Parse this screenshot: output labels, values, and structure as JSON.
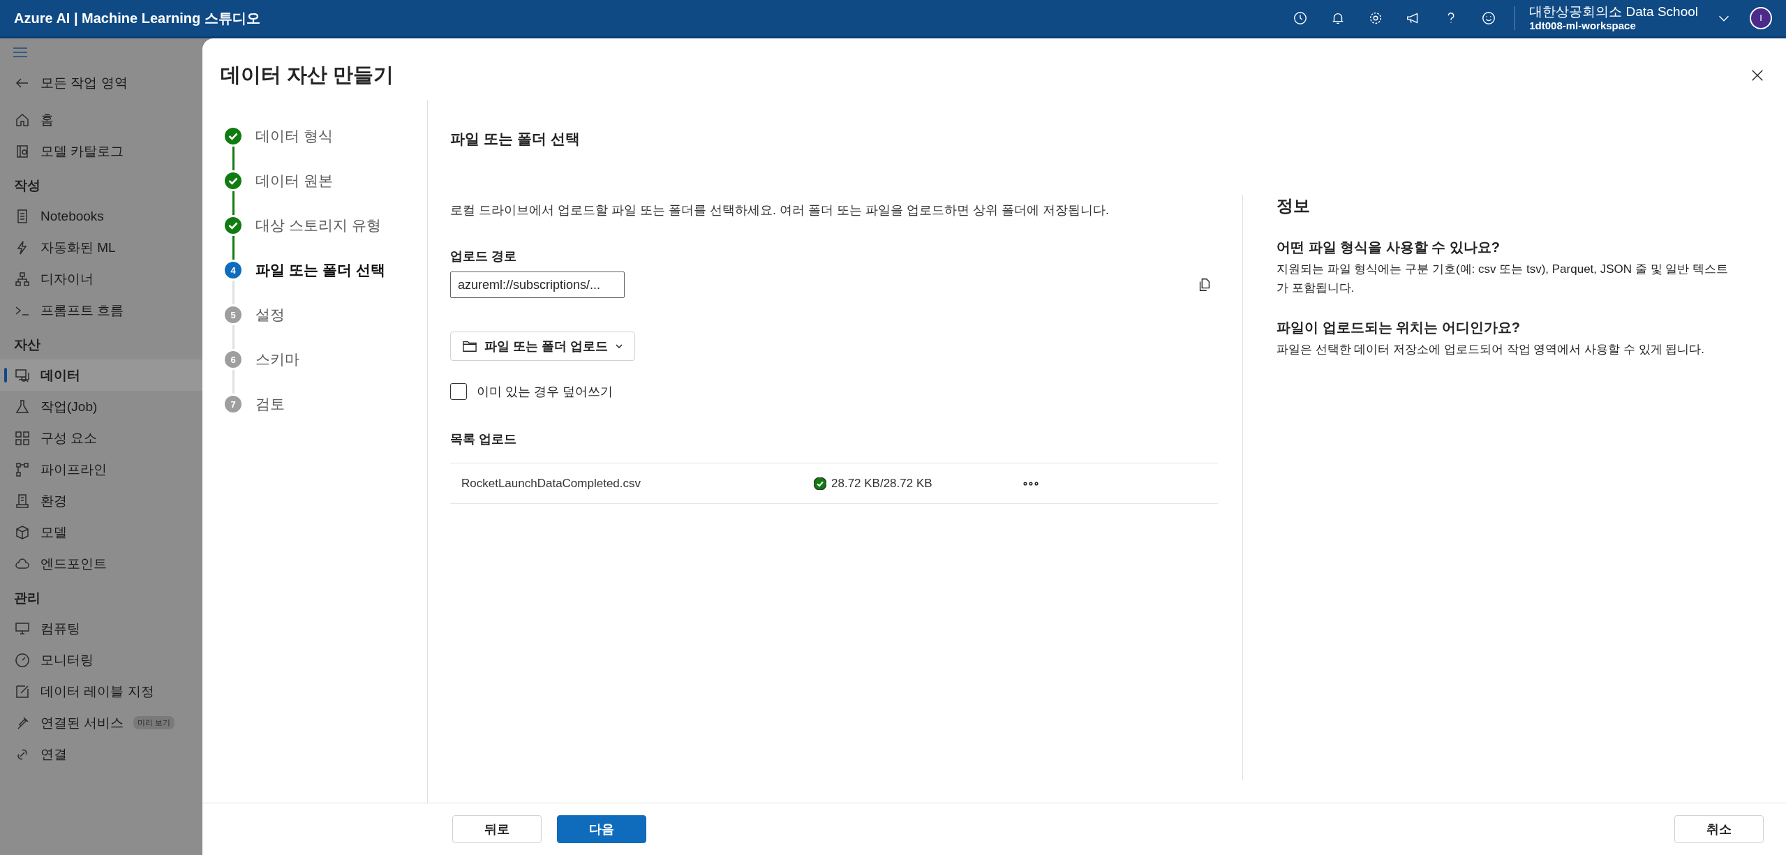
{
  "topbar": {
    "title": "Azure AI | Machine Learning 스튜디오",
    "org": "대한상공회의소 Data School",
    "workspace": "1dt008-ml-workspace",
    "avatar": "I"
  },
  "sidebar": {
    "back": "모든 작업 영역",
    "sections": [
      {
        "items": [
          {
            "label": "홈",
            "selected": false
          },
          {
            "label": "모델 카탈로그",
            "selected": false
          }
        ]
      },
      {
        "header": "작성",
        "items": [
          {
            "label": "Notebooks",
            "selected": false
          },
          {
            "label": "자동화된 ML",
            "selected": false
          },
          {
            "label": "디자이너",
            "selected": false
          },
          {
            "label": "프롬프트 흐름",
            "selected": false
          }
        ]
      },
      {
        "header": "자산",
        "items": [
          {
            "label": "데이터",
            "selected": true
          },
          {
            "label": "작업(Job)",
            "selected": false
          },
          {
            "label": "구성 요소",
            "selected": false
          },
          {
            "label": "파이프라인",
            "selected": false
          },
          {
            "label": "환경",
            "selected": false
          },
          {
            "label": "모델",
            "selected": false
          },
          {
            "label": "엔드포인트",
            "selected": false
          }
        ]
      },
      {
        "header": "관리",
        "items": [
          {
            "label": "컴퓨팅",
            "selected": false
          },
          {
            "label": "모니터링",
            "selected": false
          },
          {
            "label": "데이터 레이블 지정",
            "selected": false
          },
          {
            "label": "연결된 서비스",
            "selected": false,
            "badge": "미리 보기"
          },
          {
            "label": "연결",
            "selected": false
          }
        ]
      }
    ]
  },
  "dialog": {
    "title": "데이터 자산 만들기",
    "steps": [
      {
        "label": "데이터 형식",
        "kind": "done",
        "selected": false
      },
      {
        "label": "데이터 원본",
        "kind": "done",
        "selected": false
      },
      {
        "label": "대상 스토리지 유형",
        "kind": "done",
        "selected": false
      },
      {
        "label": "파일 또는 폴더 선택",
        "kind": "current",
        "number": "4",
        "selected": true
      },
      {
        "label": "설정",
        "kind": "pending",
        "number": "5",
        "selected": false
      },
      {
        "label": "스키마",
        "kind": "pending",
        "number": "6",
        "selected": false
      },
      {
        "label": "검토",
        "kind": "pending",
        "number": "7",
        "selected": false
      }
    ],
    "heading": "파일 또는 폴더 선택",
    "description": "로컬 드라이브에서 업로드할 파일 또는 폴더를 선택하세요. 여러 폴더 또는 파일을 업로드하면 상위 폴더에 저장됩니다.",
    "upload_path": {
      "label": "업로드 경로",
      "value": "azureml://subscriptions/..."
    },
    "upload_button": "파일 또는 폴더 업로드",
    "overwrite": {
      "label": "이미 있는 경우 덮어쓰기",
      "checked": false
    },
    "list_heading": "목록 업로드",
    "files": [
      {
        "name": "RocketLaunchDataCompleted.csv",
        "kind": "complete",
        "size": "28.72 KB/28.72 KB"
      }
    ],
    "info": {
      "title": "정보",
      "faqs": [
        {
          "question": "어떤 파일 형식을 사용할 수 있나요?",
          "answer": "지원되는 파일 형식에는 구분 기호(예: csv 또는 tsv), Parquet, JSON 줄 및 일반 텍스트가 포함됩니다."
        },
        {
          "question": "파일이 업로드되는 위치는 어디인가요?",
          "answer": "파일은 선택한 데이터 저장소에 업로드되어 작업 영역에서 사용할 수 있게 됩니다."
        }
      ]
    },
    "buttons": {
      "back": "뒤로",
      "next": "다음",
      "cancel": "취소"
    }
  }
}
